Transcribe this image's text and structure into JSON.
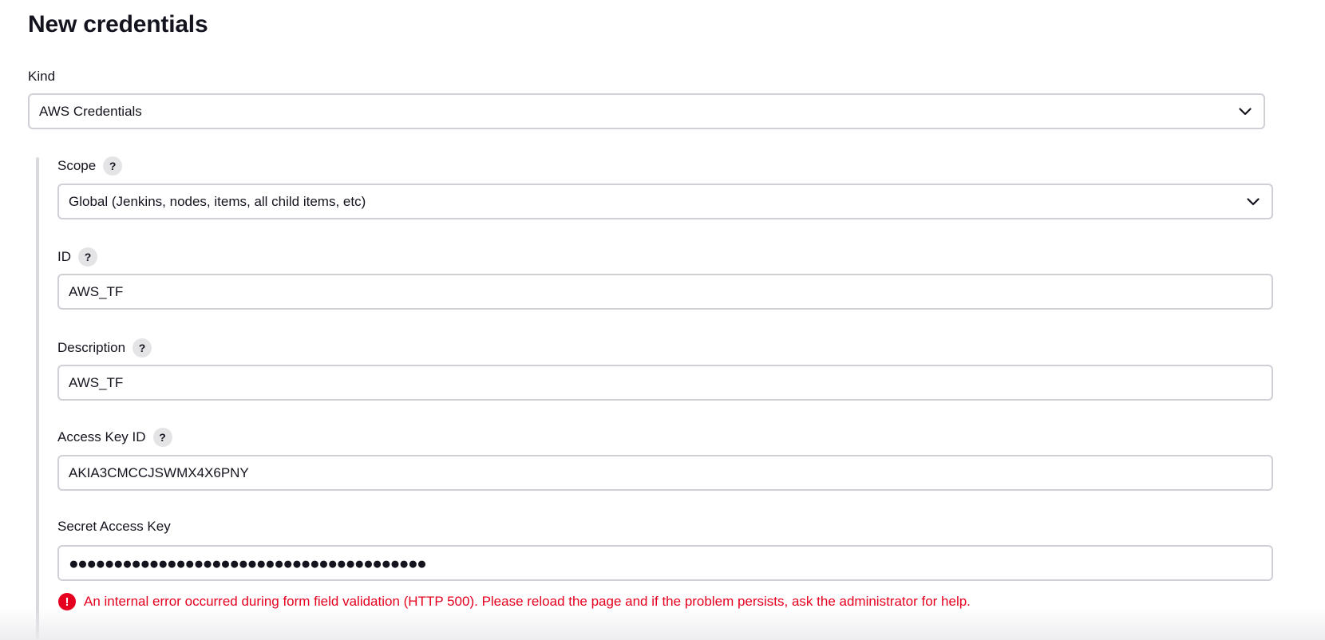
{
  "page": {
    "title": "New credentials"
  },
  "kind": {
    "label": "Kind",
    "value": "AWS Credentials"
  },
  "fields": {
    "scope": {
      "label": "Scope",
      "value": "Global (Jenkins, nodes, items, all child items, etc)",
      "help": "?"
    },
    "id": {
      "label": "ID",
      "value": "AWS_TF",
      "help": "?"
    },
    "description": {
      "label": "Description",
      "value": "AWS_TF",
      "help": "?"
    },
    "access_key_id": {
      "label": "Access Key ID",
      "value": "AKIA3CMCCJSWMX4X6PNY",
      "help": "?"
    },
    "secret_access_key": {
      "label": "Secret Access Key",
      "value": "●●●●●●●●●●●●●●●●●●●●●●●●●●●●●●●●●●●●●●●●"
    }
  },
  "validation": {
    "error_icon": "!",
    "error_message": "An internal error occurred during form field validation (HTTP 500). Please reload the page and if the problem persists, ask the administrator for help."
  },
  "icons": {
    "dropdown": "chevron-down-icon",
    "help": "question-mark-icon",
    "error": "exclamation-circle-icon"
  },
  "colors": {
    "error": "#e6001f",
    "border": "#cfd0d6",
    "help_bg": "#e4e4e7"
  }
}
